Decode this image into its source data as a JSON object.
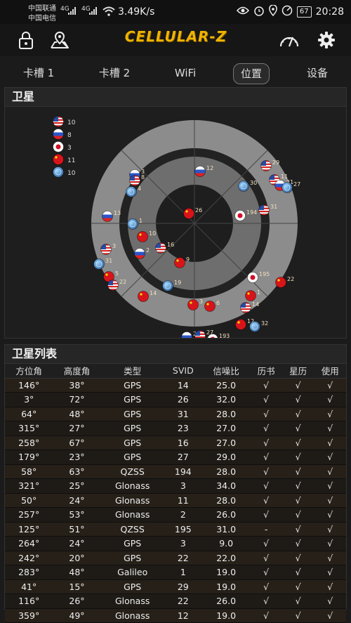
{
  "status_bar": {
    "carrier1": "中国联通",
    "carrier2": "中国电信",
    "net1": "4G",
    "net2": "4G",
    "speed": "3.49K/s",
    "battery": "67",
    "time": "20:28"
  },
  "app": {
    "title": "CELLULAR-Z"
  },
  "tabs": [
    {
      "label": "卡槽 1",
      "active": false
    },
    {
      "label": "卡槽 2",
      "active": false
    },
    {
      "label": "WiFi",
      "active": false
    },
    {
      "label": "位置",
      "active": true
    },
    {
      "label": "设备",
      "active": false
    }
  ],
  "sky_panel": {
    "title": "卫星",
    "legend": [
      {
        "constellation": "GPS",
        "count": "10"
      },
      {
        "constellation": "Glonass",
        "count": "8"
      },
      {
        "constellation": "QZSS",
        "count": "3"
      },
      {
        "constellation": "BeiDou",
        "count": "11"
      },
      {
        "constellation": "Galileo",
        "count": "10"
      }
    ],
    "sky_markers": [
      {
        "type": "GPS",
        "label": "29"
      },
      {
        "type": "QZSS",
        "label": "194"
      },
      {
        "type": "GPS",
        "label": "31"
      },
      {
        "type": "Glonass",
        "label": "12"
      },
      {
        "type": "BeiDou",
        "label": "26"
      },
      {
        "type": "Galileo",
        "label": "30"
      },
      {
        "type": "GPS",
        "label": "11"
      },
      {
        "type": "Glonass",
        "label": "21"
      },
      {
        "type": "Galileo",
        "label": "27"
      },
      {
        "type": "Glonass",
        "label": "3"
      },
      {
        "type": "GPS",
        "label": "8"
      },
      {
        "type": "Galileo",
        "label": "4"
      },
      {
        "type": "Glonass",
        "label": "13"
      },
      {
        "type": "Galileo",
        "label": "1"
      },
      {
        "type": "BeiDou",
        "label": "10"
      },
      {
        "type": "Glonass",
        "label": "2"
      },
      {
        "type": "GPS",
        "label": "16"
      },
      {
        "type": "GPS",
        "label": "3"
      },
      {
        "type": "BeiDou",
        "label": "9"
      },
      {
        "type": "Galileo",
        "label": "31"
      },
      {
        "type": "BeiDou",
        "label": "5"
      },
      {
        "type": "GPS",
        "label": "22"
      },
      {
        "type": "Galileo",
        "label": "19"
      },
      {
        "type": "BeiDou",
        "label": "14"
      },
      {
        "type": "BeiDou",
        "label": "3"
      },
      {
        "type": "BeiDou",
        "label": "6"
      },
      {
        "type": "QZSS",
        "label": "195"
      },
      {
        "type": "BeiDou",
        "label": "22"
      },
      {
        "type": "BeiDou",
        "label": "1"
      },
      {
        "type": "GPS",
        "label": "14"
      },
      {
        "type": "BeiDou",
        "label": "12"
      },
      {
        "type": "Galileo",
        "label": "32"
      },
      {
        "type": "Glonass",
        "label": "2"
      },
      {
        "type": "GPS",
        "label": "27"
      },
      {
        "type": "QZSS",
        "label": "193"
      }
    ]
  },
  "list_panel": {
    "title": "卫星列表",
    "columns": [
      "方位角",
      "高度角",
      "类型",
      "SVID",
      "信噪比",
      "历书",
      "星历",
      "使用"
    ],
    "rows": [
      [
        "146°",
        "38°",
        "GPS",
        "14",
        "25.0",
        "√",
        "√",
        "√"
      ],
      [
        "3°",
        "72°",
        "GPS",
        "26",
        "32.0",
        "√",
        "√",
        "√"
      ],
      [
        "64°",
        "48°",
        "GPS",
        "31",
        "28.0",
        "√",
        "√",
        "√"
      ],
      [
        "315°",
        "27°",
        "GPS",
        "23",
        "27.0",
        "√",
        "√",
        "√"
      ],
      [
        "258°",
        "67°",
        "GPS",
        "16",
        "27.0",
        "√",
        "√",
        "√"
      ],
      [
        "179°",
        "23°",
        "GPS",
        "27",
        "29.0",
        "√",
        "√",
        "√"
      ],
      [
        "58°",
        "63°",
        "QZSS",
        "194",
        "28.0",
        "√",
        "√",
        "√"
      ],
      [
        "321°",
        "25°",
        "Glonass",
        "3",
        "34.0",
        "√",
        "√",
        "√"
      ],
      [
        "50°",
        "24°",
        "Glonass",
        "11",
        "28.0",
        "√",
        "√",
        "√"
      ],
      [
        "257°",
        "53°",
        "Glonass",
        "2",
        "26.0",
        "√",
        "√",
        "√"
      ],
      [
        "125°",
        "51°",
        "QZSS",
        "195",
        "31.0",
        "-",
        "√",
        "√"
      ],
      [
        "264°",
        "24°",
        "GPS",
        "3",
        "9.0",
        "√",
        "√",
        "√"
      ],
      [
        "242°",
        "20°",
        "GPS",
        "22",
        "22.0",
        "√",
        "√",
        "√"
      ],
      [
        "283°",
        "48°",
        "Galileo",
        "1",
        "19.0",
        "√",
        "√",
        "√"
      ],
      [
        "41°",
        "15°",
        "GPS",
        "29",
        "19.0",
        "√",
        "√",
        "√"
      ],
      [
        "116°",
        "26°",
        "Glonass",
        "22",
        "26.0",
        "√",
        "√",
        "√"
      ],
      [
        "359°",
        "49°",
        "Glonass",
        "12",
        "19.0",
        "√",
        "√",
        "√"
      ]
    ]
  },
  "colors": {
    "accent": "#f0b400",
    "ring_outer": "#8c8c8c",
    "ring_inner": "#6e6e6e",
    "background": "#1b1b1b"
  }
}
